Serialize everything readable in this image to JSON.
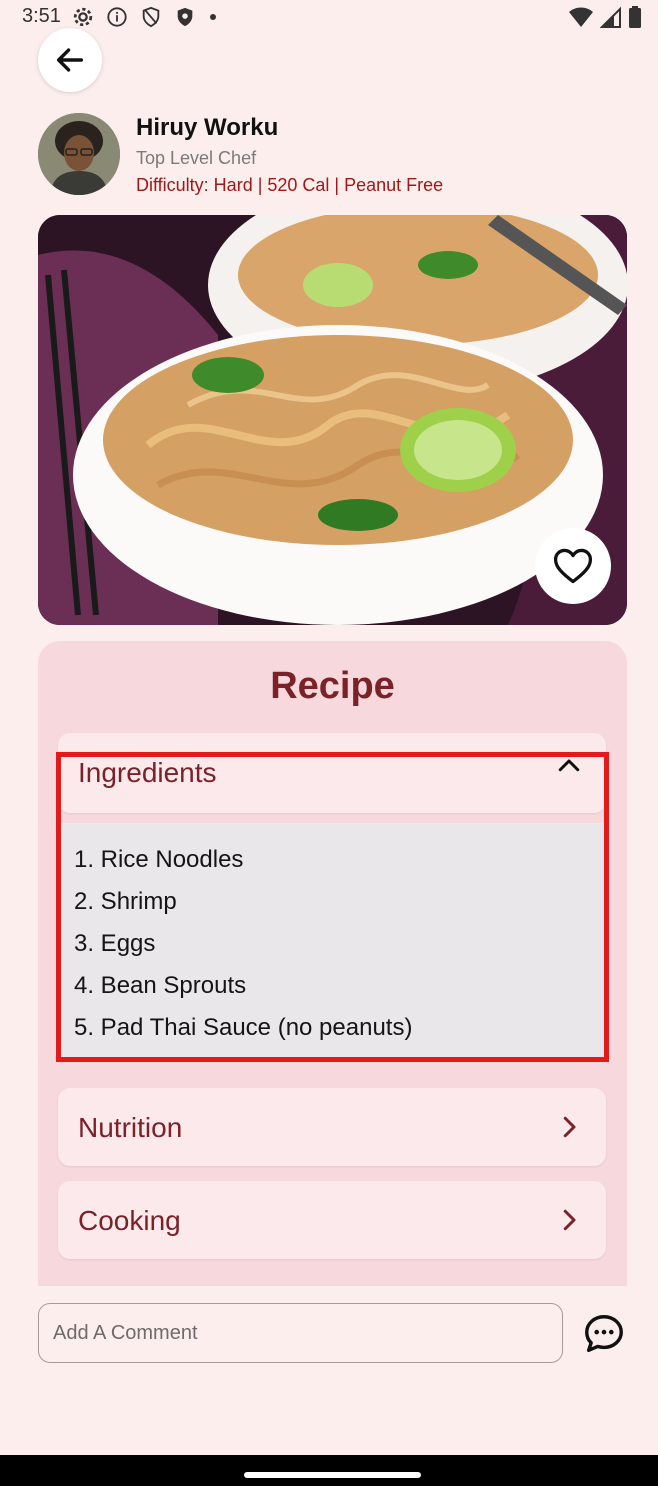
{
  "status_bar": {
    "time": "3:51"
  },
  "chef": {
    "name": "Hiruy Worku",
    "title": "Top Level Chef",
    "meta": "Difficulty: Hard | 520 Cal | Peanut Free"
  },
  "recipe": {
    "heading": "Recipe",
    "sections": [
      {
        "label": "Ingredients",
        "expanded": true
      },
      {
        "label": "Nutrition",
        "expanded": false
      },
      {
        "label": "Cooking",
        "expanded": false
      }
    ],
    "ingredients": [
      "1. Rice Noodles",
      "2. Shrimp",
      "3. Eggs",
      "4. Bean Sprouts",
      "5. Pad Thai Sauce (no peanuts)"
    ]
  },
  "comment": {
    "placeholder": "Add A Comment"
  },
  "colors": {
    "background": "#fdeeee",
    "accent": "#7a2228",
    "meta_text": "#a11818",
    "card": "#f7d9dd",
    "highlight": "#e21a1a"
  },
  "icons": {
    "back": "arrow-left-icon",
    "favorite": "heart-outline-icon",
    "expand": "chevron-up-icon",
    "collapse": "chevron-right-icon",
    "comment": "chat-bubble-icon"
  }
}
